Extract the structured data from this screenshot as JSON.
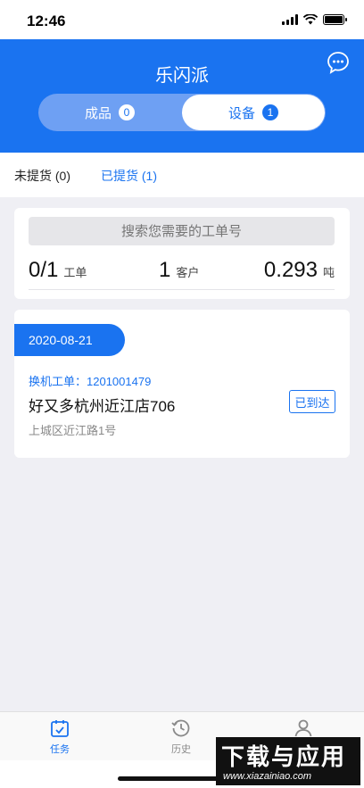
{
  "status_bar": {
    "time": "12:46"
  },
  "header": {
    "title": "乐闪派",
    "chat_icon": "chat-bubble-icon",
    "segments": [
      {
        "label": "成品",
        "count": "0",
        "selected": false
      },
      {
        "label": "设备",
        "count": "1",
        "selected": true
      }
    ]
  },
  "subtabs": [
    {
      "label": "未提货 (0)",
      "active": false
    },
    {
      "label": "已提货 (1)",
      "active": true
    }
  ],
  "summary": {
    "search_placeholder": "搜索您需要的工单号",
    "stats": [
      {
        "value": "0/1",
        "unit": "工单"
      },
      {
        "value": "1",
        "unit": "客户"
      },
      {
        "value": "0.293",
        "unit": "吨"
      }
    ]
  },
  "order": {
    "date": "2020-08-21",
    "order_label": "换机工单：1201001479",
    "store_name": "好又多杭州近江店706",
    "address": "上城区近江路1号",
    "status": "已到达"
  },
  "tabbar": {
    "items": [
      {
        "label": "任务",
        "icon": "calendar-check-icon",
        "active": true
      },
      {
        "label": "历史",
        "icon": "history-clock-icon",
        "active": false
      },
      {
        "label": "",
        "icon": "user-icon",
        "active": false
      }
    ]
  },
  "watermark": {
    "title": "下载与应用",
    "url": "www.xiazainiao.com"
  },
  "colors": {
    "primary": "#1a73f0",
    "background": "#efeff4"
  }
}
